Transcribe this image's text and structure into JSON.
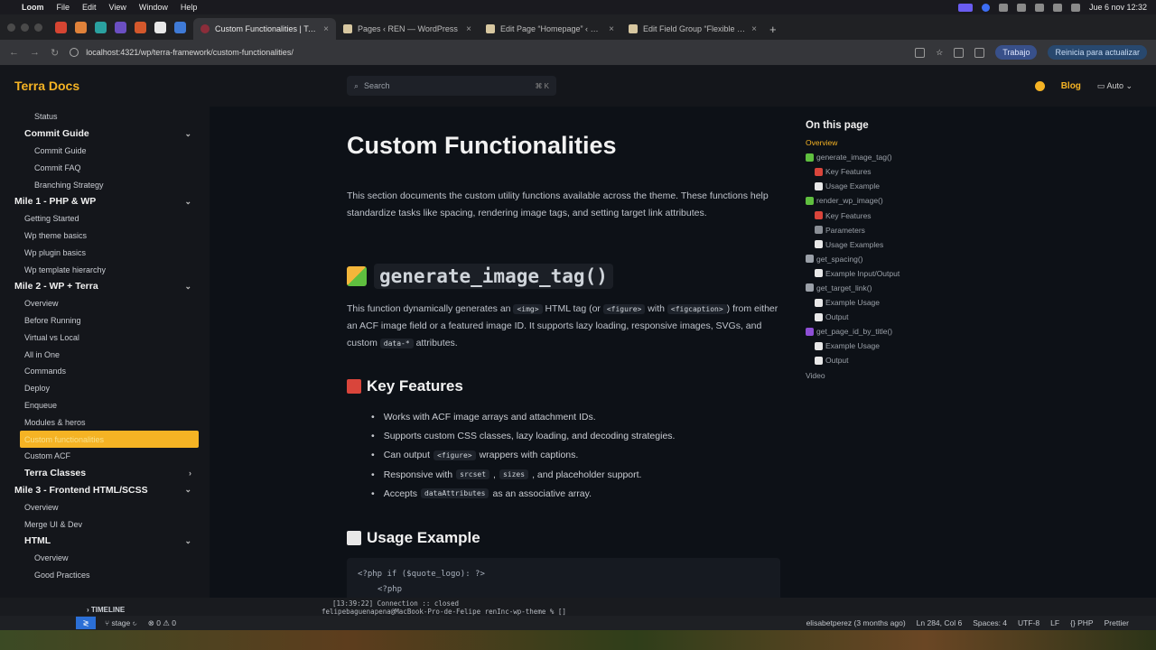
{
  "menubar": {
    "app": "Loom",
    "items": [
      "File",
      "Edit",
      "View",
      "Window",
      "Help"
    ],
    "clock": "Jue 6 nov 12:32"
  },
  "browser": {
    "tabs": [
      {
        "title": "Custom Functionalities | Terra",
        "active": true
      },
      {
        "title": "Pages ‹ REN — WordPress",
        "active": false
      },
      {
        "title": "Edit Page “Homepage” ‹ REN",
        "active": false
      },
      {
        "title": "Edit Field Group “Flexible Mo",
        "active": false
      }
    ],
    "url": "localhost:4321/wp/terra-framework/custom-functionalities/",
    "profile_label": "Trabajo",
    "update_label": "Reinicia para actualizar"
  },
  "header": {
    "site_title": "Terra Docs",
    "search_placeholder": "Search",
    "search_shortcut": "⌘ K",
    "blog_label": "Blog",
    "theme_label": "Auto"
  },
  "sidebar": {
    "rows": [
      {
        "label": "Status",
        "level": 2
      },
      {
        "label": "Commit Guide",
        "level": 1,
        "group": true,
        "chevron": "down"
      },
      {
        "label": "Commit Guide",
        "level": 2
      },
      {
        "label": "Commit FAQ",
        "level": 2
      },
      {
        "label": "Branching Strategy",
        "level": 2
      },
      {
        "label": "Mile 1 - PHP & WP",
        "level": 0,
        "group": true,
        "chevron": "down"
      },
      {
        "label": "Getting Started",
        "level": 1
      },
      {
        "label": "Wp theme basics",
        "level": 1
      },
      {
        "label": "Wp plugin basics",
        "level": 1
      },
      {
        "label": "Wp template hierarchy",
        "level": 1
      },
      {
        "label": "Mile 2 - WP + Terra",
        "level": 0,
        "group": true,
        "chevron": "down"
      },
      {
        "label": "Overview",
        "level": 1
      },
      {
        "label": "Before Running",
        "level": 1
      },
      {
        "label": "Virtual vs Local",
        "level": 1
      },
      {
        "label": "All in One",
        "level": 1
      },
      {
        "label": "Commands",
        "level": 1
      },
      {
        "label": "Deploy",
        "level": 1
      },
      {
        "label": "Enqueue",
        "level": 1
      },
      {
        "label": "Modules & heros",
        "level": 1
      },
      {
        "label": "Custom functionalities",
        "level": 1,
        "active": true
      },
      {
        "label": "Custom ACF",
        "level": 1
      },
      {
        "label": "Terra Classes",
        "level": 1,
        "group": true,
        "chevron": "right"
      },
      {
        "label": "Mile 3 - Frontend HTML/SCSS",
        "level": 0,
        "group": true,
        "chevron": "down"
      },
      {
        "label": "Overview",
        "level": 1
      },
      {
        "label": "Merge UI & Dev",
        "level": 1
      },
      {
        "label": "HTML",
        "level": 1,
        "group": true,
        "chevron": "down"
      },
      {
        "label": "Overview",
        "level": 2
      },
      {
        "label": "Good Practices",
        "level": 2
      }
    ]
  },
  "article": {
    "title": "Custom Functionalities",
    "intro": "This section documents the custom utility functions available across the theme. These functions help standardize tasks like spacing, rendering image tags, and setting target link attributes.",
    "section1_title": "generate_image_tag()",
    "section1_desc_parts": {
      "a": "This function dynamically generates an ",
      "code1": "<img>",
      "b": " HTML tag (or ",
      "code2": "<figure>",
      "c": " with ",
      "code3": "<figcaption>",
      "d": ") from either an ACF image field or a featured image ID. It supports lazy loading, responsive images, SVGs, and custom ",
      "code4": "data-*",
      "e": " attributes."
    },
    "key_features_title": "Key Features",
    "features": [
      {
        "pre": "Works with ACF image arrays and attachment IDs.",
        "code": "",
        "post": ""
      },
      {
        "pre": "Supports custom CSS classes, lazy loading, and decoding strategies.",
        "code": "",
        "post": ""
      },
      {
        "pre": "Can output ",
        "code": "<figure>",
        "post": " wrappers with captions."
      },
      {
        "pre": "Responsive with ",
        "code": "srcset",
        "mid": ", ",
        "code2": "sizes",
        "post": ", and placeholder support."
      },
      {
        "pre": "Accepts ",
        "code": "dataAttributes",
        "post": " as an associative array."
      }
    ],
    "usage_title": "Usage Example",
    "code_lines": [
      "<?php if ($quote_logo): ?>",
      "<?php"
    ]
  },
  "toc": {
    "title": "On this page",
    "items": [
      {
        "label": "Overview",
        "level": 1,
        "active": true,
        "marker": ""
      },
      {
        "label": "generate_image_tag()",
        "level": 1,
        "marker": "#5fbf3f"
      },
      {
        "label": "Key Features",
        "level": 2,
        "marker": "#d9453b"
      },
      {
        "label": "Usage Example",
        "level": 2,
        "marker": "#e8e8e8"
      },
      {
        "label": "render_wp_image()",
        "level": 1,
        "marker": "#5fbf3f"
      },
      {
        "label": "Key Features",
        "level": 2,
        "marker": "#d9453b"
      },
      {
        "label": "Parameters",
        "level": 2,
        "marker": "#8a8f96"
      },
      {
        "label": "Usage Examples",
        "level": 2,
        "marker": "#e8e8e8"
      },
      {
        "label": "get_spacing()",
        "level": 1,
        "marker": "#9aa0a8"
      },
      {
        "label": "Example Input/Output",
        "level": 2,
        "marker": "#e8e8e8"
      },
      {
        "label": "get_target_link()",
        "level": 1,
        "marker": "#9aa0a8"
      },
      {
        "label": "Example Usage",
        "level": 2,
        "marker": "#e8e8e8"
      },
      {
        "label": "Output",
        "level": 2,
        "marker": "#e8e8e8"
      },
      {
        "label": "get_page_id_by_title()",
        "level": 1,
        "marker": "#8e4fd6"
      },
      {
        "label": "Example Usage",
        "level": 2,
        "marker": "#e8e8e8"
      },
      {
        "label": "Output",
        "level": 2,
        "marker": "#e8e8e8"
      },
      {
        "label": "Video",
        "level": 1,
        "marker": ""
      }
    ]
  },
  "terminal": {
    "line1": "[13:39:22] Connection :: closed",
    "line2": "felipebaguenapena@MacBook-Pro-de-Felipe renInc-wp-theme % []",
    "timeline_label": "TIMELINE"
  },
  "statusbar": {
    "branch": "stage",
    "problems": "⊗ 0 ⚠ 0",
    "blame": "elisabetperez (3 months ago)",
    "position": "Ln 284, Col 6",
    "spaces": "Spaces: 4",
    "encoding": "UTF-8",
    "eol": "LF",
    "language": "PHP",
    "formatter": "Prettier"
  },
  "colors": {
    "accent": "#f5b324",
    "background": "#0d1117",
    "sidebar": "#14161b"
  }
}
